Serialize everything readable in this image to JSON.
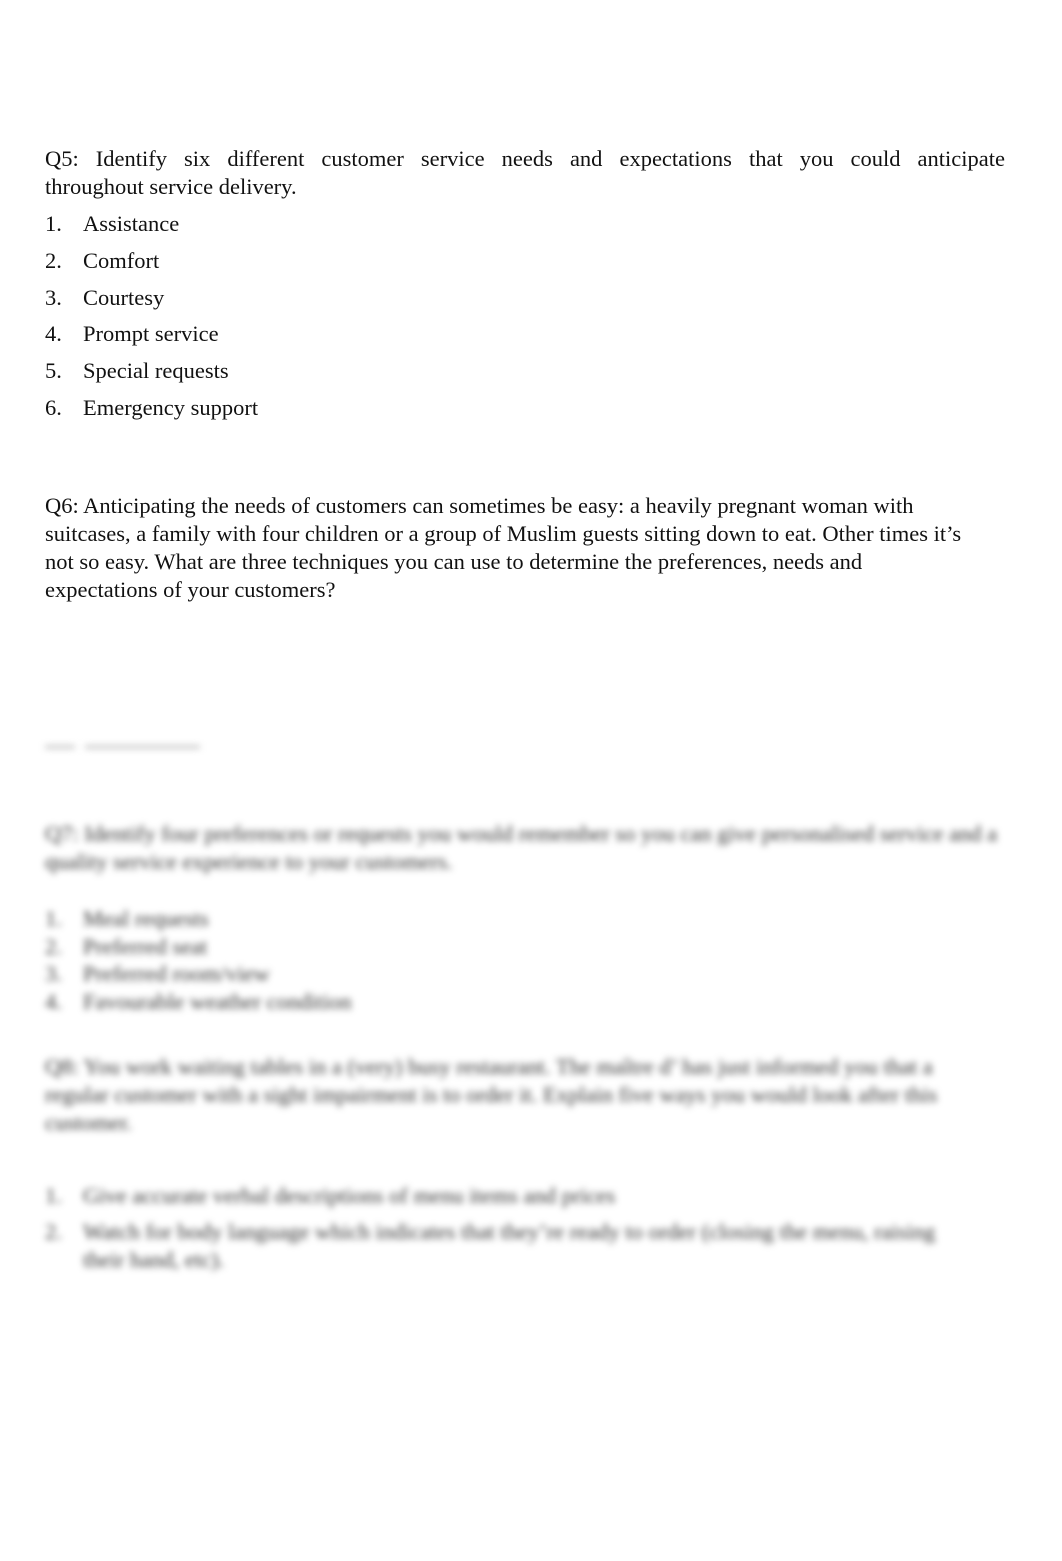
{
  "q5": {
    "line1": "Q5: Identify six different customer service needs and expectations that you could anticipate",
    "line2": "throughout service delivery.",
    "answers": [
      {
        "num": "1.",
        "text": "Assistance"
      },
      {
        "num": "2.",
        "text": "Comfort"
      },
      {
        "num": "3.",
        "text": "Courtesy"
      },
      {
        "num": "4.",
        "text": "Prompt service"
      },
      {
        "num": "5.",
        "text": "Special requests"
      },
      {
        "num": "6.",
        "text": "Emergency support"
      }
    ]
  },
  "q6": {
    "text": "Q6: Anticipating the needs of customers can sometimes be easy: a heavily pregnant woman with suitcases, a family with four children or a group of Muslim guests sitting down to eat.  Other times it’s not so easy. What are three techniques you can use to determine the preferences, needs and expectations of your customers?"
  },
  "blurred": {
    "q7": {
      "text": "Q7: Identify four preferences or requests you would remember so you can give personalised service and a quality service experience to your customers.",
      "answers": [
        {
          "num": "1.",
          "text": "Meal requests"
        },
        {
          "num": "2.",
          "text": "Preferred seat"
        },
        {
          "num": "3.",
          "text": "Preferred room/view"
        },
        {
          "num": "4.",
          "text": "Favourable weather condition"
        }
      ]
    },
    "q8": {
      "text": "Q8: You work waiting tables in a (very) busy restaurant. The maître d’ has just informed you that a regular customer with a sight impairment is to order it. Explain five ways you would look after this customer.",
      "answers": [
        {
          "num": "1.",
          "text": "Give accurate verbal descriptions of menu items and prices"
        },
        {
          "num": "2.",
          "text": "Watch for body language which indicates that they’re ready to order (closing the menu, raising their hand, etc)."
        }
      ]
    }
  }
}
